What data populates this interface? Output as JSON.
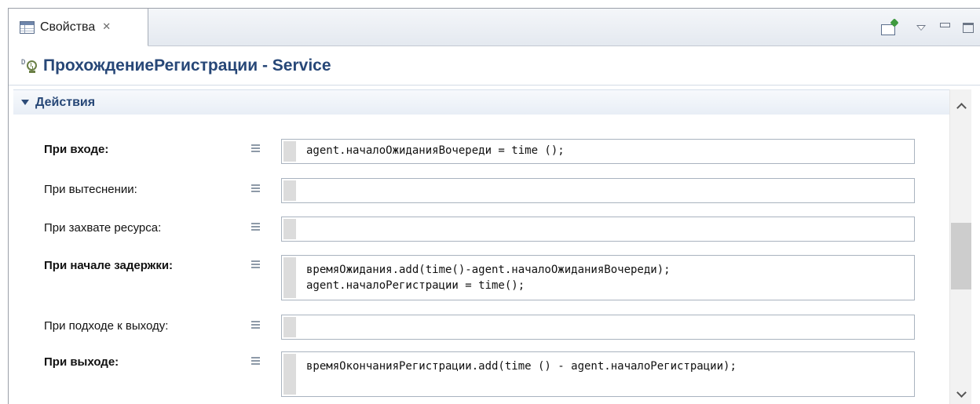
{
  "tab": {
    "title": "Свойства",
    "close_glyph": "✕",
    "icon": "properties-table-icon"
  },
  "toolbar": {
    "pin_icon": "pin-view-icon",
    "menu_icon": "view-menu-icon",
    "minimize_icon": "minimize-icon",
    "maximize_icon": "maximize-icon"
  },
  "header": {
    "icon": "service-block-icon",
    "title": "ПрохождениеРегистрации - Service"
  },
  "section": {
    "title": "Действия",
    "expanded": true
  },
  "rows": [
    {
      "label": "При входе:",
      "bold": true,
      "code": "agent.началоОжиданияВочереди = time ();"
    },
    {
      "label": "При вытеснении:",
      "bold": false,
      "code": ""
    },
    {
      "label": "При захвате ресурса:",
      "bold": false,
      "code": ""
    },
    {
      "label": "При начале задержки:",
      "bold": true,
      "code": "времяОжидания.add(time()-agent.началоОжиданияВочереди);\nagent.началоРегистрации = time();"
    },
    {
      "label": "При подходе к выходу:",
      "bold": false,
      "code": ""
    },
    {
      "label": "При выходе:",
      "bold": true,
      "code": "времяОкончанияРегистрации.add(time () - agent.началоРегистрации);"
    }
  ],
  "colors": {
    "title_blue": "#274777",
    "tab_bar_bg": "#e4e9f0",
    "field_border": "#a9b3bf"
  }
}
